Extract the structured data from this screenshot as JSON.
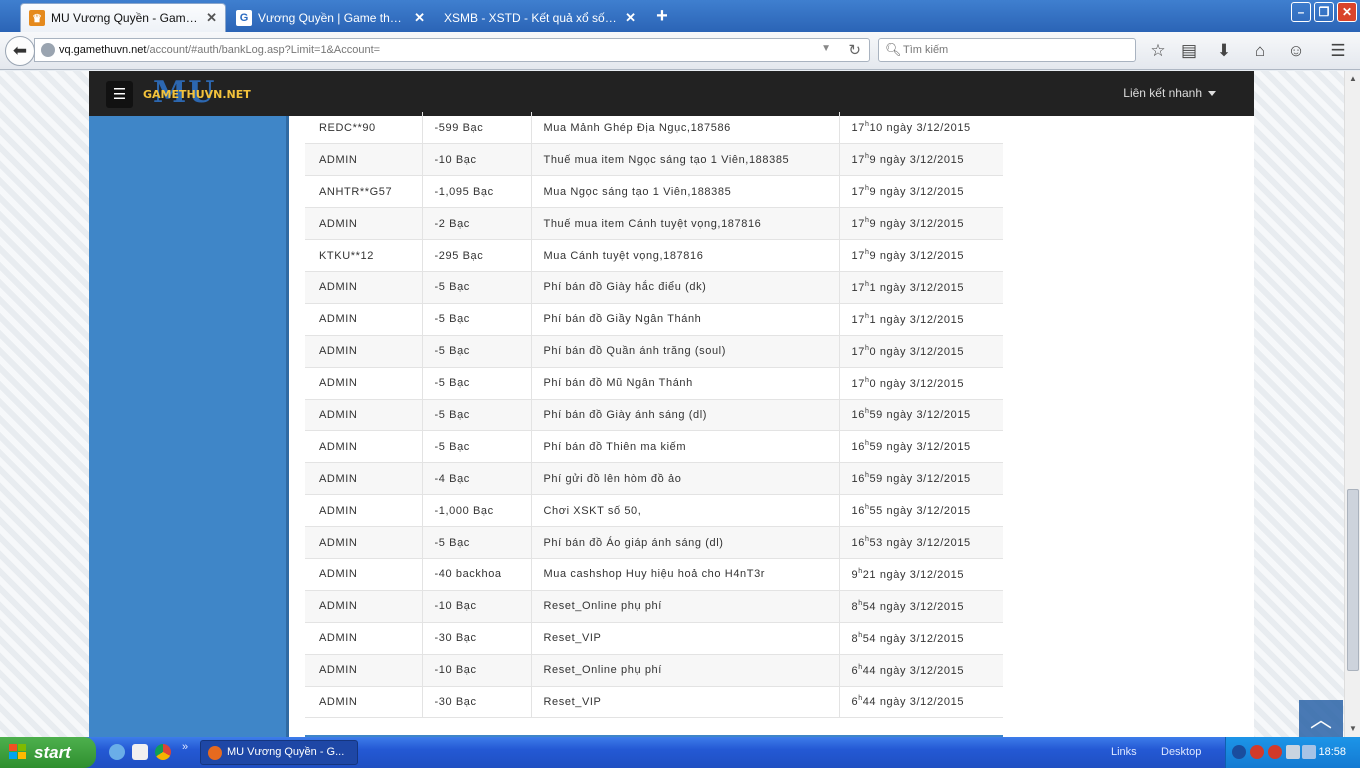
{
  "browser": {
    "tabs": [
      {
        "title": "MU Vương Quyền - GamethuV...",
        "active": true,
        "favicon": "crown-icon"
      },
      {
        "title": "Vương Quyền | Game thủ Việt...",
        "active": false,
        "favicon": "g-icon"
      },
      {
        "title": "XSMB - XSTD - Kết quả xổ số Miền ...",
        "active": false,
        "favicon": ""
      }
    ],
    "url_host": "vq.gamethuvn.net",
    "url_path": "/account/#auth/bankLog.asp?Limit=1&Account=",
    "search_placeholder": "Tìm kiếm"
  },
  "site": {
    "logo_text": "GAMETHUVN.NET",
    "logo_mark": "MU",
    "quick_links": "Liên kết nhanh"
  },
  "bank_log": {
    "rows": [
      {
        "account": "REDC**90",
        "amount": "-599  Bạc",
        "description": "Mua Mảnh Ghép Địa Ngục,187586",
        "hour": "17",
        "minute": "10",
        "date": "ngày 3/12/2015"
      },
      {
        "account": "ADMIN",
        "amount": "-10  Bạc",
        "description": "Thuế mua item Ngọc sáng tạo 1 Viên,188385",
        "hour": "17",
        "minute": "9",
        "date": "ngày 3/12/2015"
      },
      {
        "account": "ANHTR**G57",
        "amount": "-1,095  Bạc",
        "description": "Mua Ngọc sáng tạo 1 Viên,188385",
        "hour": "17",
        "minute": "9",
        "date": "ngày 3/12/2015"
      },
      {
        "account": "ADMIN",
        "amount": "-2  Bạc",
        "description": "Thuế mua item Cánh tuyệt vọng,187816",
        "hour": "17",
        "minute": "9",
        "date": "ngày 3/12/2015"
      },
      {
        "account": "KTKU**12",
        "amount": "-295  Bạc",
        "description": "Mua Cánh tuyệt vọng,187816",
        "hour": "17",
        "minute": "9",
        "date": "ngày 3/12/2015"
      },
      {
        "account": "ADMIN",
        "amount": "-5  Bạc",
        "description": "Phí bán đồ Giày hắc điểu (dk)",
        "hour": "17",
        "minute": "1",
        "date": "ngày 3/12/2015"
      },
      {
        "account": "ADMIN",
        "amount": "-5  Bạc",
        "description": "Phí bán đồ Giầy Ngân Thánh",
        "hour": "17",
        "minute": "1",
        "date": "ngày 3/12/2015"
      },
      {
        "account": "ADMIN",
        "amount": "-5  Bạc",
        "description": "Phí bán đồ Quần ánh trăng (soul)",
        "hour": "17",
        "minute": "0",
        "date": "ngày 3/12/2015"
      },
      {
        "account": "ADMIN",
        "amount": "-5  Bạc",
        "description": "Phí bán đồ Mũ Ngân Thánh",
        "hour": "17",
        "minute": "0",
        "date": "ngày 3/12/2015"
      },
      {
        "account": "ADMIN",
        "amount": "-5  Bạc",
        "description": "Phí bán đồ Giày ánh sáng (dl)",
        "hour": "16",
        "minute": "59",
        "date": "ngày 3/12/2015"
      },
      {
        "account": "ADMIN",
        "amount": "-5  Bạc",
        "description": "Phí bán đồ Thiên ma kiếm",
        "hour": "16",
        "minute": "59",
        "date": "ngày 3/12/2015"
      },
      {
        "account": "ADMIN",
        "amount": "-4  Bạc",
        "description": "Phí gửi đồ lên hòm đồ ảo",
        "hour": "16",
        "minute": "59",
        "date": "ngày 3/12/2015"
      },
      {
        "account": "ADMIN",
        "amount": "-1,000  Bạc",
        "description": "Chơi XSKT số 50,",
        "hour": "16",
        "minute": "55",
        "date": "ngày 3/12/2015"
      },
      {
        "account": "ADMIN",
        "amount": "-5  Bạc",
        "description": "Phí bán đồ Áo giáp ánh sáng (dl)",
        "hour": "16",
        "minute": "53",
        "date": "ngày 3/12/2015"
      },
      {
        "account": "ADMIN",
        "amount": "-40  backhoa",
        "description": "Mua cashshop Huy hiệu hoả cho H4nT3r",
        "hour": "9",
        "minute": "21",
        "date": "ngày 3/12/2015"
      },
      {
        "account": "ADMIN",
        "amount": "-10  Bạc",
        "description": "Reset_Online phụ phí",
        "hour": "8",
        "minute": "54",
        "date": "ngày 3/12/2015"
      },
      {
        "account": "ADMIN",
        "amount": "-30  Bạc",
        "description": "Reset_VIP",
        "hour": "8",
        "minute": "54",
        "date": "ngày 3/12/2015"
      },
      {
        "account": "ADMIN",
        "amount": "-10  Bạc",
        "description": "Reset_Online phụ phí",
        "hour": "6",
        "minute": "44",
        "date": "ngày 3/12/2015"
      },
      {
        "account": "ADMIN",
        "amount": "-30  Bạc",
        "description": "Reset_VIP",
        "hour": "6",
        "minute": "44",
        "date": "ngày 3/12/2015"
      }
    ],
    "hour_sup": "h"
  },
  "taskbar": {
    "start_label": "start",
    "task_label": "MU Vương Quyền - G...",
    "links_label": "Links",
    "desktop_label": "Desktop",
    "clock": "18:58"
  },
  "colors": {
    "accent_blue": "#3f86c8",
    "header_dark": "#222222",
    "logo_gold": "#f3c23b"
  }
}
